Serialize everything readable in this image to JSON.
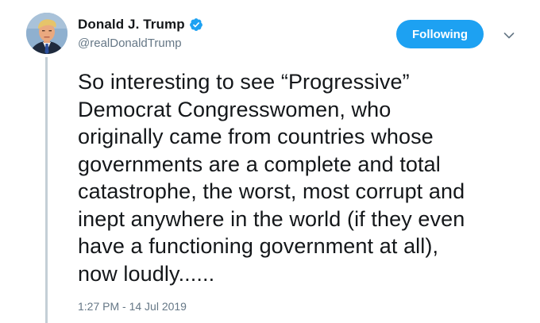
{
  "user": {
    "display_name": "Donald J. Trump",
    "handle": "@realDonaldTrump",
    "verified": true,
    "avatar_icon": "profile-photo"
  },
  "actions": {
    "follow_label": "Following",
    "menu_icon": "chevron-down-icon"
  },
  "tweet": {
    "text": "So interesting to see “Progressive”\nDemocrat Congresswomen, who\noriginally came from countries whose\ngovernments are a complete and total\ncatastrophe, the worst, most corrupt and\ninept anywhere in the world (if they even\nhave a functioning government at all),\nnow loudly......",
    "timestamp": "1:27 PM - 14 Jul 2019"
  },
  "colors": {
    "accent": "#1da1f2",
    "text": "#14171a",
    "secondary_text": "#657786",
    "thread_line": "#c4cfd6"
  }
}
